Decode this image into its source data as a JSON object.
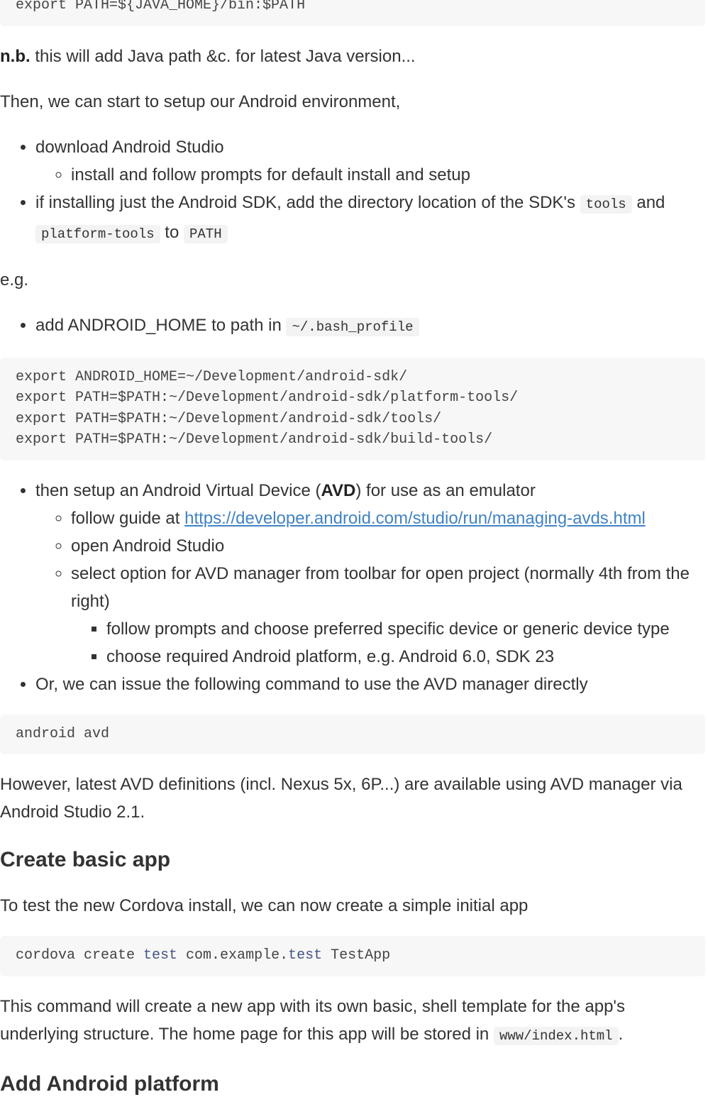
{
  "code_java": "export PATH=${JAVA_HOME}/bin:$PATH",
  "nb": {
    "bold": "n.b.",
    "text": " this will add Java path &c. for latest Java version..."
  },
  "then_setup": "Then, we can start to setup our Android environment,",
  "list1": {
    "item1": "download Android Studio",
    "item1_sub1": "install and follow prompts for default install and setup",
    "item2_pre": "if installing just the Android SDK, add the directory location of the SDK's ",
    "item2_code1": "tools",
    "item2_mid1": " and",
    "item2_code2": "platform-tools",
    "item2_mid2": " to ",
    "item2_code3": "PATH"
  },
  "eg": "e.g.",
  "list2": {
    "item1_pre": "add ANDROID_HOME to path in ",
    "item1_code": "~/.bash_profile"
  },
  "code_android": [
    "export ANDROID_HOME=~/Development/android-sdk/",
    "export PATH=$PATH:~/Development/android-sdk/platform-tools/",
    "export PATH=$PATH:~/Development/android-sdk/tools/",
    "export PATH=$PATH:~/Development/android-sdk/build-tools/"
  ],
  "list3": {
    "avd_pre": "then setup an Android Virtual Device (",
    "avd_bold": "AVD",
    "avd_post": ") for use as an emulator",
    "guide_pre": "follow guide at ",
    "guide_link": "https://developer.android.com/studio/run/managing-avds.html",
    "open_studio": "open Android Studio",
    "select_option": "select option for AVD manager from toolbar for open project (normally 4th from the right)",
    "follow_prompts": "follow prompts and choose preferred specific device or generic device type",
    "choose_platform": "choose required Android platform, e.g. Android 6.0, SDK 23",
    "or_issue": "Or, we can issue the following command to use the AVD manager directly"
  },
  "code_avd": "android avd",
  "however": "However, latest AVD definitions (incl. Nexus 5x, 6P...) are available using AVD manager via Android Studio 2.1.",
  "h_create": "Create basic app",
  "to_test": "To test the new Cordova install, we can now create a simple initial app",
  "code_cordova": {
    "p1": "cordova create ",
    "k1": "test",
    "p2": " com.example.",
    "k2": "test",
    "p3": " TestApp"
  },
  "this_command_pre": "This command will create a new app with its own basic, shell template for the app's underlying structure. The home page for this app will be stored in ",
  "this_command_code": "www/index.html",
  "this_command_post": ".",
  "h_add_android": "Add Android platform"
}
